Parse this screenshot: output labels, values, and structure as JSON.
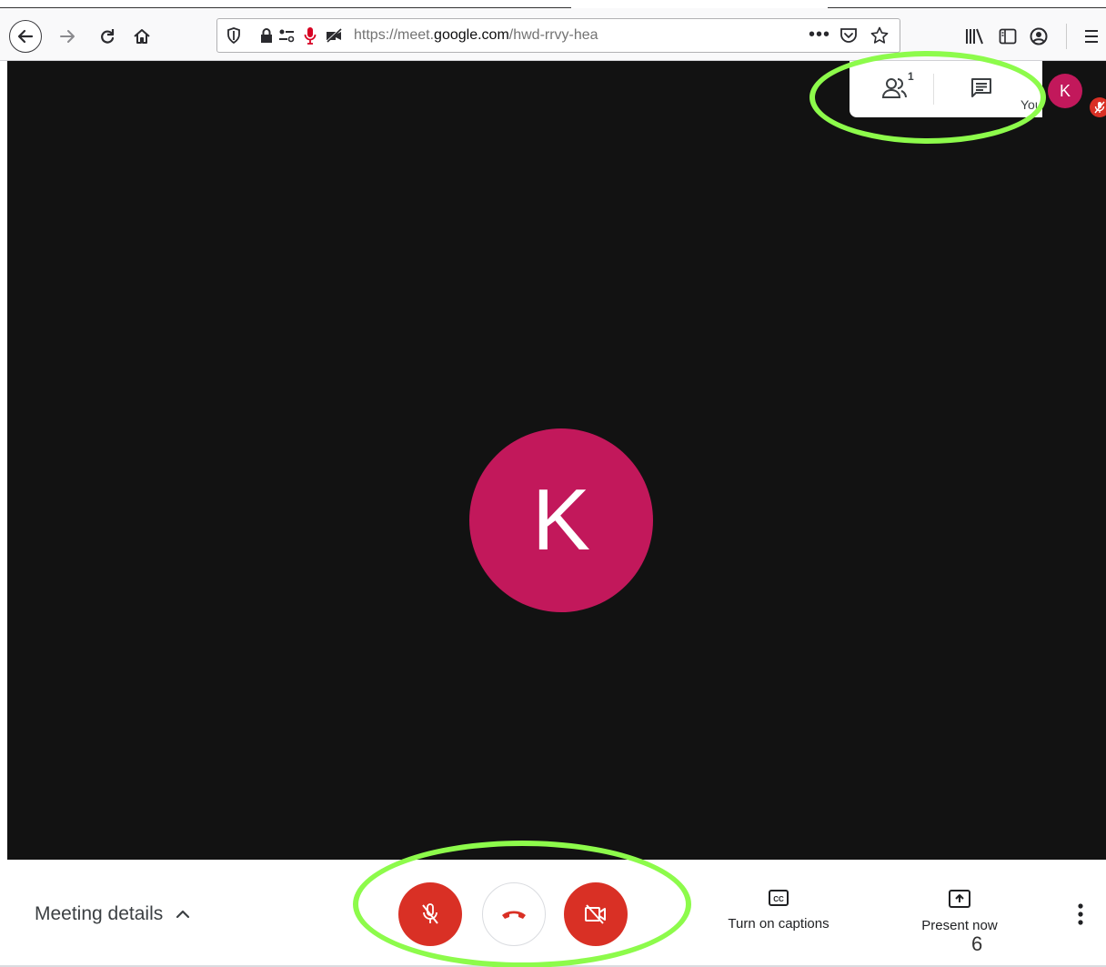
{
  "browser": {
    "url_prefix": "https://meet.",
    "url_domain": "google.com",
    "url_path": "/hwd-rrvy-hea",
    "more_label": "•••"
  },
  "meeting": {
    "participant_initial": "K",
    "participant_color": "#c2185b",
    "self_initial": "K",
    "you_label": "You",
    "participant_count": "1"
  },
  "controls": {
    "meeting_details_label": "Meeting details",
    "captions_label": "Turn on captions",
    "present_label": "Present now",
    "mic_state": "muted",
    "camera_state": "off",
    "accent_red": "#d93025"
  },
  "annotations": {
    "highlight_color": "#8dfb4b",
    "page_number": "6"
  }
}
